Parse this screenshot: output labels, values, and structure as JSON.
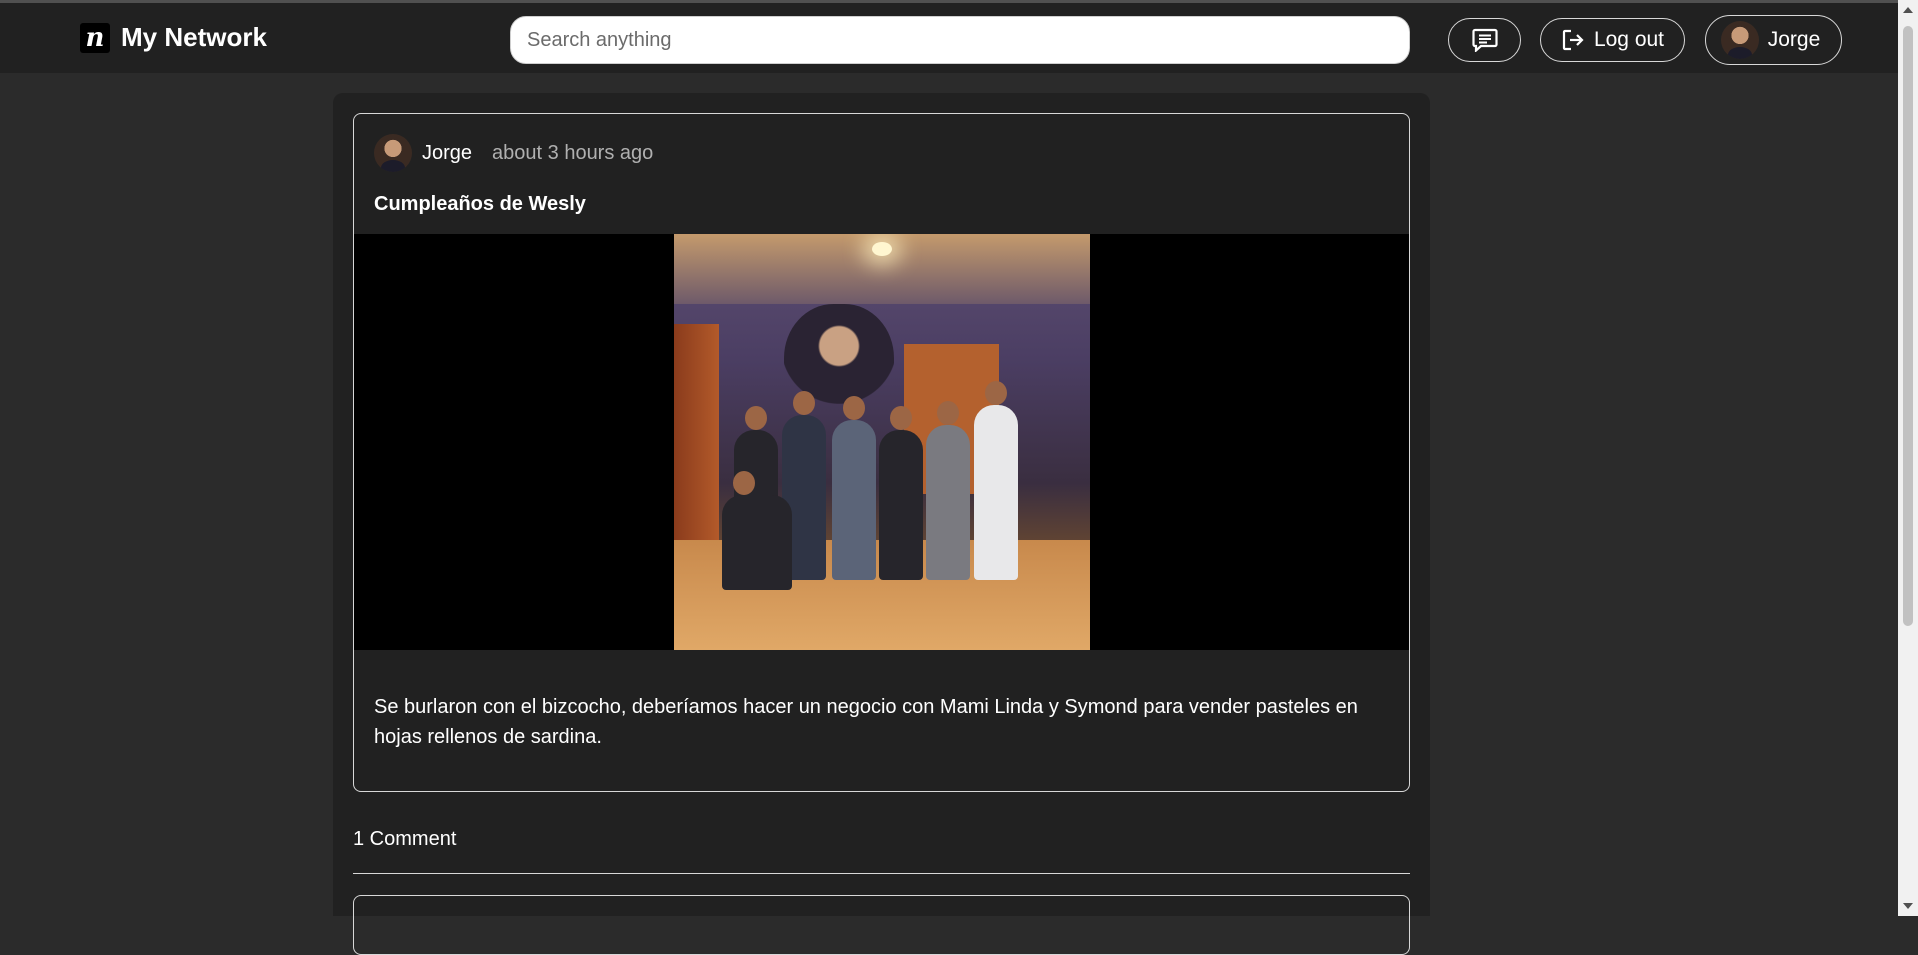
{
  "header": {
    "brand_glyph": "n",
    "brand_name": "My Network",
    "search_placeholder": "Search anything",
    "chat_icon": "chat-icon",
    "logout_label": "Log out",
    "profile_name": "Jorge"
  },
  "post": {
    "author": "Jorge",
    "time": "about 3 hours ago",
    "title": "Cumpleaños de Wesly",
    "body": "Se burlaron con el bizcocho, deberíamos hacer un negocio con Mami Linda y Symond para vender pasteles en hojas rellenos de sardina."
  },
  "comments": {
    "count_label": "1 Comment"
  },
  "colors": {
    "page_bg": "#2b2b2b",
    "bar_bg": "#212121",
    "panel_bg": "#212121",
    "text": "#ffffff",
    "muted": "#b0b0b0",
    "media_bg": "#000000"
  }
}
